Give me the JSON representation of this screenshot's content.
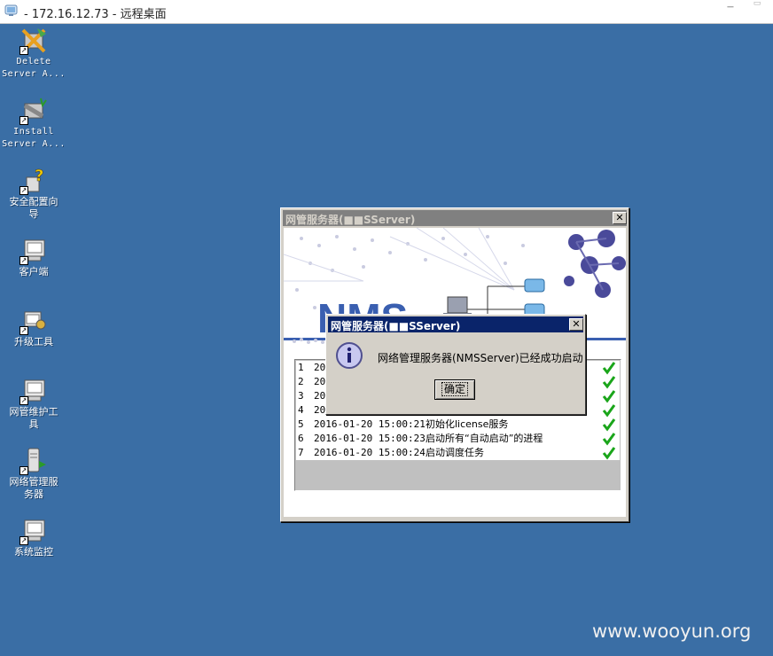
{
  "window": {
    "title": " - 172.16.12.73 - 远程桌面"
  },
  "desktop_icons": [
    {
      "label_line1": "Delete",
      "label_line2": "Server A...",
      "icon": "delete-server-icon"
    },
    {
      "label_line1": "Install",
      "label_line2": "Server A...",
      "icon": "install-server-icon"
    },
    {
      "label_line1": "安全配置向",
      "label_line2": "导",
      "icon": "security-wizard-icon"
    },
    {
      "label_line1": "客户端",
      "label_line2": "",
      "icon": "client-icon"
    },
    {
      "label_line1": "升级工具",
      "label_line2": "",
      "icon": "upgrade-tool-icon"
    },
    {
      "label_line1": "网管维护工",
      "label_line2": "具",
      "icon": "maintenance-tool-icon"
    },
    {
      "label_line1": "网络管理服",
      "label_line2": "务器",
      "icon": "network-server-icon"
    },
    {
      "label_line1": "系统监控",
      "label_line2": "",
      "icon": "system-monitor-icon"
    }
  ],
  "nms_window": {
    "title": "网管服务器(■■SServer)",
    "close": "✕",
    "logo": "NMS",
    "log_rows": [
      {
        "n": "1",
        "date": "201",
        "msg": ""
      },
      {
        "n": "2",
        "date": "201",
        "msg": ""
      },
      {
        "n": "3",
        "date": "201",
        "msg": ""
      },
      {
        "n": "4",
        "date": "201",
        "msg": ""
      },
      {
        "n": "5",
        "date": "2016-01-20 15:00:21",
        "msg": "初始化license服务"
      },
      {
        "n": "6",
        "date": "2016-01-20 15:00:23",
        "msg": "启动所有“自动启动”的进程"
      },
      {
        "n": "7",
        "date": "2016-01-20 15:00:24",
        "msg": "启动调度任务"
      }
    ]
  },
  "dialog": {
    "title": "网管服务器(■■SServer)",
    "close": "✕",
    "message": "网络管理服务器(NMSServer)已经成功启动",
    "ok_label": "确定"
  },
  "watermark": "www.wooyun.org",
  "colors": {
    "desktop": "#3a6ea5",
    "dialog_title": "#0a246a",
    "inactive_title": "#808080",
    "check": "#1aa51a"
  }
}
